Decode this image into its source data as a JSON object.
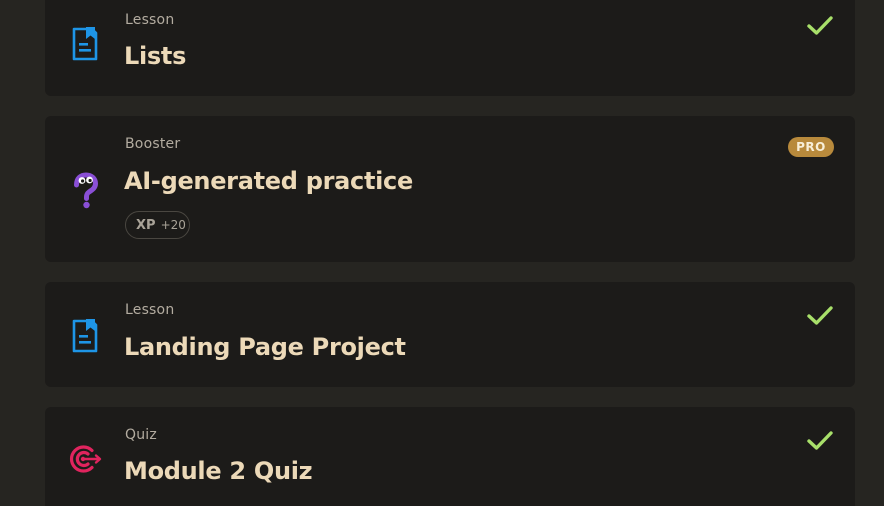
{
  "colors": {
    "page_background": "#262521",
    "card_background": "#1c1b19",
    "title_text": "#ecd9b8",
    "type_text": "#b3aca0",
    "check": "#a8e06a",
    "lesson_icon": "#1e95e6",
    "booster_icon": "#8a4fd6",
    "quiz_icon": "#e0245e",
    "pro_badge": "#b88a3c"
  },
  "items": [
    {
      "type": "Lesson",
      "title": "Lists",
      "icon": "lesson-document-icon",
      "completed": true
    },
    {
      "type": "Booster",
      "title": "AI-generated practice",
      "icon": "question-mark-character-icon",
      "badge": "PRO",
      "xp_label": "XP",
      "xp_value": "+20",
      "completed": false
    },
    {
      "type": "Lesson",
      "title": "Landing Page Project",
      "icon": "lesson-document-icon",
      "completed": true
    },
    {
      "type": "Quiz",
      "title": "Module 2 Quiz",
      "icon": "quiz-target-icon",
      "completed": true
    }
  ]
}
